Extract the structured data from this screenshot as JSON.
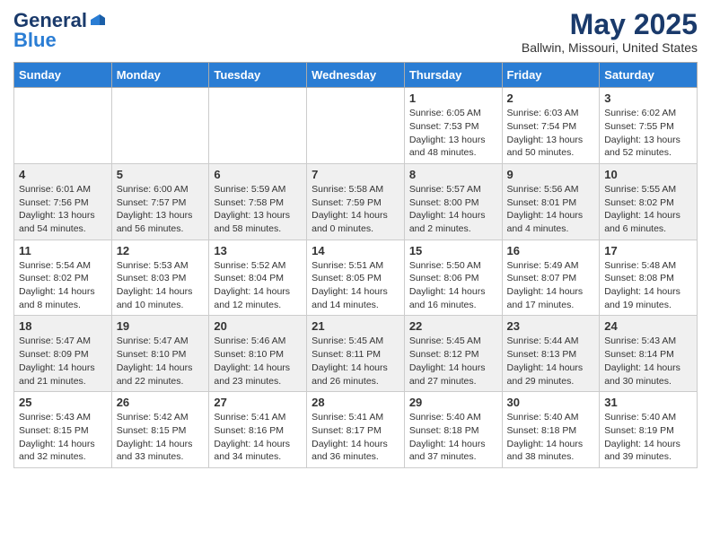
{
  "header": {
    "logo_line1": "General",
    "logo_line2": "Blue",
    "month": "May 2025",
    "location": "Ballwin, Missouri, United States"
  },
  "days_of_week": [
    "Sunday",
    "Monday",
    "Tuesday",
    "Wednesday",
    "Thursday",
    "Friday",
    "Saturday"
  ],
  "weeks": [
    [
      {
        "day": "",
        "info": ""
      },
      {
        "day": "",
        "info": ""
      },
      {
        "day": "",
        "info": ""
      },
      {
        "day": "",
        "info": ""
      },
      {
        "day": "1",
        "info": "Sunrise: 6:05 AM\nSunset: 7:53 PM\nDaylight: 13 hours\nand 48 minutes."
      },
      {
        "day": "2",
        "info": "Sunrise: 6:03 AM\nSunset: 7:54 PM\nDaylight: 13 hours\nand 50 minutes."
      },
      {
        "day": "3",
        "info": "Sunrise: 6:02 AM\nSunset: 7:55 PM\nDaylight: 13 hours\nand 52 minutes."
      }
    ],
    [
      {
        "day": "4",
        "info": "Sunrise: 6:01 AM\nSunset: 7:56 PM\nDaylight: 13 hours\nand 54 minutes."
      },
      {
        "day": "5",
        "info": "Sunrise: 6:00 AM\nSunset: 7:57 PM\nDaylight: 13 hours\nand 56 minutes."
      },
      {
        "day": "6",
        "info": "Sunrise: 5:59 AM\nSunset: 7:58 PM\nDaylight: 13 hours\nand 58 minutes."
      },
      {
        "day": "7",
        "info": "Sunrise: 5:58 AM\nSunset: 7:59 PM\nDaylight: 14 hours\nand 0 minutes."
      },
      {
        "day": "8",
        "info": "Sunrise: 5:57 AM\nSunset: 8:00 PM\nDaylight: 14 hours\nand 2 minutes."
      },
      {
        "day": "9",
        "info": "Sunrise: 5:56 AM\nSunset: 8:01 PM\nDaylight: 14 hours\nand 4 minutes."
      },
      {
        "day": "10",
        "info": "Sunrise: 5:55 AM\nSunset: 8:02 PM\nDaylight: 14 hours\nand 6 minutes."
      }
    ],
    [
      {
        "day": "11",
        "info": "Sunrise: 5:54 AM\nSunset: 8:02 PM\nDaylight: 14 hours\nand 8 minutes."
      },
      {
        "day": "12",
        "info": "Sunrise: 5:53 AM\nSunset: 8:03 PM\nDaylight: 14 hours\nand 10 minutes."
      },
      {
        "day": "13",
        "info": "Sunrise: 5:52 AM\nSunset: 8:04 PM\nDaylight: 14 hours\nand 12 minutes."
      },
      {
        "day": "14",
        "info": "Sunrise: 5:51 AM\nSunset: 8:05 PM\nDaylight: 14 hours\nand 14 minutes."
      },
      {
        "day": "15",
        "info": "Sunrise: 5:50 AM\nSunset: 8:06 PM\nDaylight: 14 hours\nand 16 minutes."
      },
      {
        "day": "16",
        "info": "Sunrise: 5:49 AM\nSunset: 8:07 PM\nDaylight: 14 hours\nand 17 minutes."
      },
      {
        "day": "17",
        "info": "Sunrise: 5:48 AM\nSunset: 8:08 PM\nDaylight: 14 hours\nand 19 minutes."
      }
    ],
    [
      {
        "day": "18",
        "info": "Sunrise: 5:47 AM\nSunset: 8:09 PM\nDaylight: 14 hours\nand 21 minutes."
      },
      {
        "day": "19",
        "info": "Sunrise: 5:47 AM\nSunset: 8:10 PM\nDaylight: 14 hours\nand 22 minutes."
      },
      {
        "day": "20",
        "info": "Sunrise: 5:46 AM\nSunset: 8:10 PM\nDaylight: 14 hours\nand 23 minutes."
      },
      {
        "day": "21",
        "info": "Sunrise: 5:45 AM\nSunset: 8:11 PM\nDaylight: 14 hours\nand 26 minutes."
      },
      {
        "day": "22",
        "info": "Sunrise: 5:45 AM\nSunset: 8:12 PM\nDaylight: 14 hours\nand 27 minutes."
      },
      {
        "day": "23",
        "info": "Sunrise: 5:44 AM\nSunset: 8:13 PM\nDaylight: 14 hours\nand 29 minutes."
      },
      {
        "day": "24",
        "info": "Sunrise: 5:43 AM\nSunset: 8:14 PM\nDaylight: 14 hours\nand 30 minutes."
      }
    ],
    [
      {
        "day": "25",
        "info": "Sunrise: 5:43 AM\nSunset: 8:15 PM\nDaylight: 14 hours\nand 32 minutes."
      },
      {
        "day": "26",
        "info": "Sunrise: 5:42 AM\nSunset: 8:15 PM\nDaylight: 14 hours\nand 33 minutes."
      },
      {
        "day": "27",
        "info": "Sunrise: 5:41 AM\nSunset: 8:16 PM\nDaylight: 14 hours\nand 34 minutes."
      },
      {
        "day": "28",
        "info": "Sunrise: 5:41 AM\nSunset: 8:17 PM\nDaylight: 14 hours\nand 36 minutes."
      },
      {
        "day": "29",
        "info": "Sunrise: 5:40 AM\nSunset: 8:18 PM\nDaylight: 14 hours\nand 37 minutes."
      },
      {
        "day": "30",
        "info": "Sunrise: 5:40 AM\nSunset: 8:18 PM\nDaylight: 14 hours\nand 38 minutes."
      },
      {
        "day": "31",
        "info": "Sunrise: 5:40 AM\nSunset: 8:19 PM\nDaylight: 14 hours\nand 39 minutes."
      }
    ]
  ]
}
